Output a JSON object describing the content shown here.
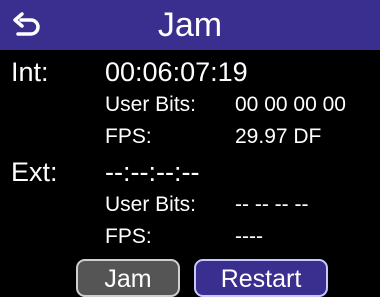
{
  "header": {
    "title": "Jam",
    "back_icon": "back-arrow-icon"
  },
  "internal": {
    "label": "Int:",
    "timecode": "00:06:07:19",
    "user_bits_label": "User Bits:",
    "user_bits_value": "00 00 00 00",
    "fps_label": "FPS:",
    "fps_value": "29.97 DF"
  },
  "external": {
    "label": "Ext:",
    "timecode": "--:--:--:--",
    "user_bits_label": "User Bits:",
    "user_bits_value": "-- -- -- --",
    "fps_label": "FPS:",
    "fps_value": "----"
  },
  "buttons": {
    "jam_label": "Jam",
    "restart_label": "Restart"
  },
  "colors": {
    "title_bar": "#3a2e8e",
    "background": "#000000",
    "text": "#ffffff",
    "jam_button": "#555555",
    "restart_button": "#3a2e8e"
  }
}
